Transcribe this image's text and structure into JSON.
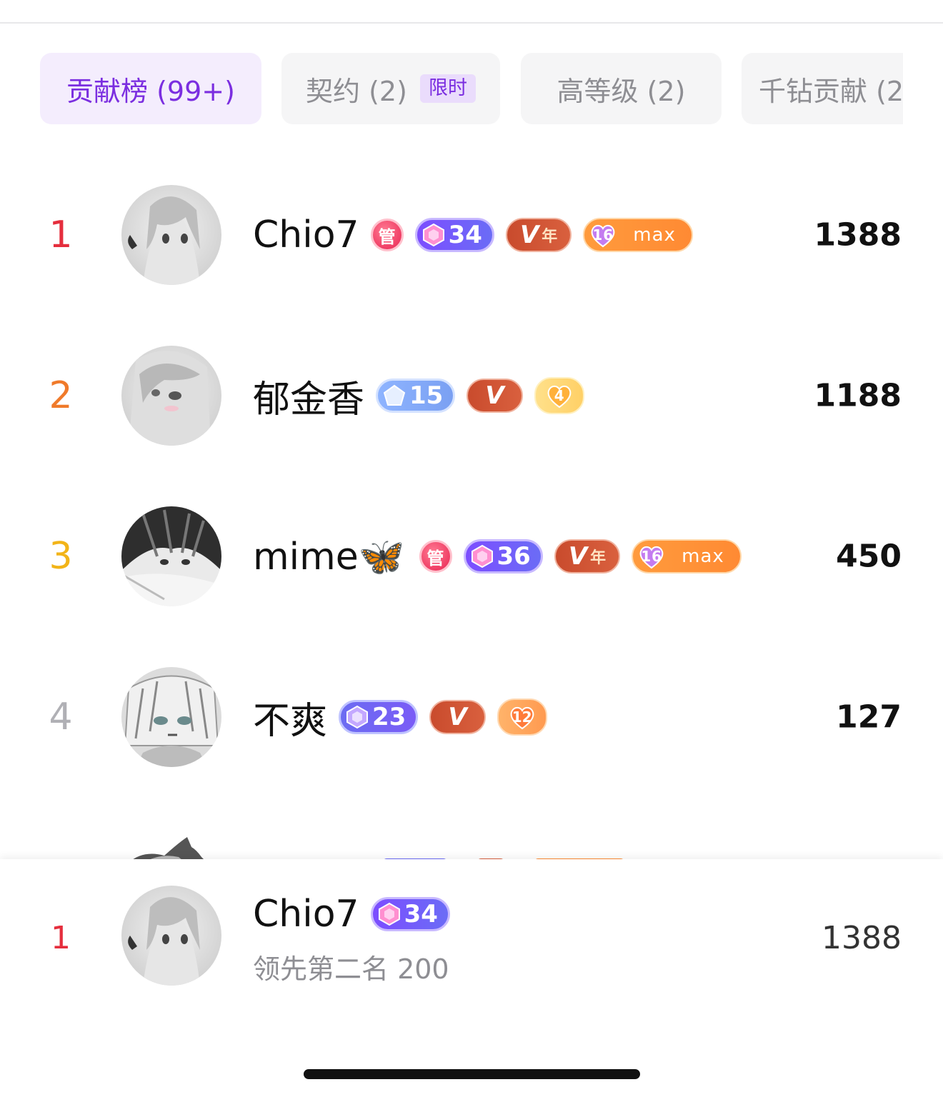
{
  "tabs": [
    {
      "label": "贡献榜 (99+)",
      "active": true
    },
    {
      "label": "契约 (2)",
      "tag": "限时"
    },
    {
      "label": "高等级 (2)"
    },
    {
      "label": "千钻贡献 (2"
    }
  ],
  "ranking": [
    {
      "rank": "1",
      "rank_color": "#e52e3d",
      "name": "Chio7",
      "level": "34",
      "v_year": "年",
      "fan_level": "16",
      "fan_text": "max",
      "score": "1388"
    },
    {
      "rank": "2",
      "rank_color": "#f07a2a",
      "name": "郁金香",
      "level": "15",
      "heart_level": "4",
      "score": "1188"
    },
    {
      "rank": "3",
      "rank_color": "#f2b418",
      "name": "mime🦋",
      "level": "36",
      "v_year": "年",
      "fan_level": "16",
      "fan_text": "max",
      "score": "450"
    },
    {
      "rank": "4",
      "rank_color": "#b0b0b5",
      "name": "不爽",
      "level": "23",
      "heart_level": "12",
      "score": "127"
    }
  ],
  "badges": {
    "guan": "管",
    "v": "V"
  },
  "me": {
    "rank": "1",
    "name": "Chio7",
    "level": "34",
    "subtitle": "领先第二名 200",
    "score": "1388"
  }
}
